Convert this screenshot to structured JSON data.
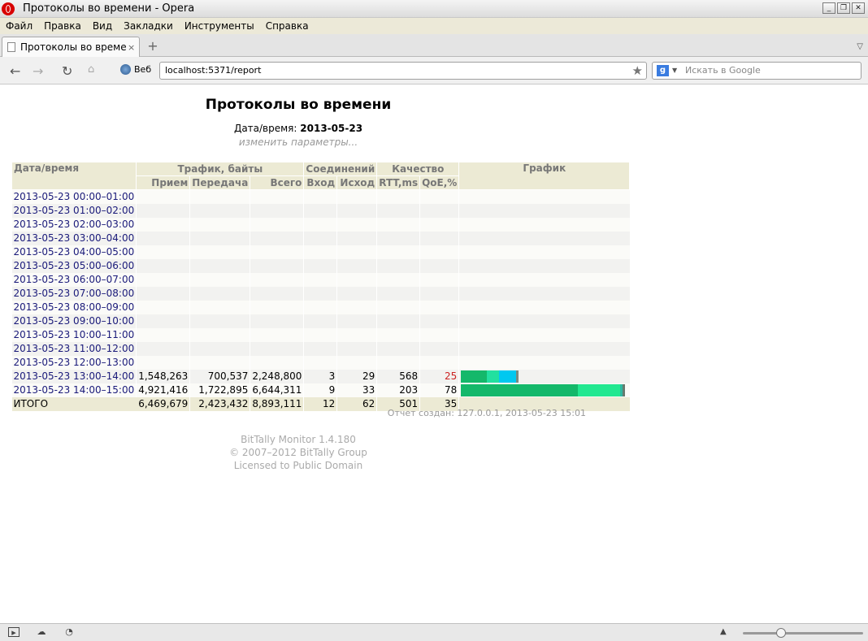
{
  "window": {
    "title": "Протоколы во времени - Opera",
    "buttons": [
      "_",
      "❐",
      "✕"
    ]
  },
  "menu": [
    "Файл",
    "Правка",
    "Вид",
    "Закладки",
    "Инструменты",
    "Справка"
  ],
  "tab": {
    "title": "Протоколы во времени",
    "close": "×",
    "new": "+"
  },
  "nav": {
    "web_label": "Веб",
    "url": "localhost:5371/report",
    "search_placeholder": "Искать в Google",
    "search_engine": "g"
  },
  "page": {
    "title": "Протоколы во времени",
    "date_label": "Дата/время:",
    "date_value": "2013-05-23",
    "change_link": "изменить параметры...",
    "generated": "Отчет создан: 127.0.0.1, 2013-05-23 15:01",
    "credits": [
      "BitTally Monitor 1.4.180",
      "© 2007–2012 BitTally Group",
      "Licensed to Public Domain"
    ]
  },
  "table": {
    "headers": {
      "datetime": "Дата/время",
      "traffic": "Трафик, байты",
      "connections": "Соединений",
      "quality": "Качество",
      "chart": "График",
      "rx": "Прием",
      "tx": "Передача",
      "total": "Всего",
      "in": "Вход",
      "out": "Исход",
      "rtt": "RTT,ms",
      "qoe": "QoE,%"
    },
    "rows": [
      {
        "period": "2013-05-23 00:00–01:00"
      },
      {
        "period": "2013-05-23 01:00–02:00"
      },
      {
        "period": "2013-05-23 02:00–03:00"
      },
      {
        "period": "2013-05-23 03:00–04:00"
      },
      {
        "period": "2013-05-23 04:00–05:00"
      },
      {
        "period": "2013-05-23 05:00–06:00"
      },
      {
        "period": "2013-05-23 06:00–07:00"
      },
      {
        "period": "2013-05-23 07:00–08:00"
      },
      {
        "period": "2013-05-23 08:00–09:00"
      },
      {
        "period": "2013-05-23 09:00–10:00"
      },
      {
        "period": "2013-05-23 10:00–11:00"
      },
      {
        "period": "2013-05-23 11:00–12:00"
      },
      {
        "period": "2013-05-23 12:00–13:00"
      },
      {
        "period": "2013-05-23 13:00–14:00",
        "rx": "1,548,263",
        "tx": "700,537",
        "total": "2,248,800",
        "in": "3",
        "out": "29",
        "rtt": "568",
        "qoe": "25",
        "qoe_low": true,
        "bar_segments": [
          {
            "value": 0.155,
            "color": "#14b86a"
          },
          {
            "value": 0.07,
            "color": "#22e0a0"
          },
          {
            "value": 0.105,
            "color": "#00c8f0"
          },
          {
            "value": 0.015,
            "color": "#7a8a80"
          }
        ]
      },
      {
        "period": "2013-05-23 14:00–15:00",
        "rx": "4,921,416",
        "tx": "1,722,895",
        "total": "6,644,311",
        "in": "9",
        "out": "33",
        "rtt": "203",
        "qoe": "78",
        "bar_segments": [
          {
            "value": 0.7,
            "color": "#14b86a"
          },
          {
            "value": 0.25,
            "color": "#22e890"
          },
          {
            "value": 0.015,
            "color": "#2fb8a0"
          },
          {
            "value": 0.015,
            "color": "#667a6e"
          }
        ]
      }
    ],
    "total_row": {
      "period": "ИТОГО",
      "rx": "6,469,679",
      "tx": "2,423,432",
      "total": "8,893,111",
      "in": "12",
      "out": "62",
      "rtt": "501",
      "qoe": "35"
    }
  },
  "status": {
    "zoom_level": 0.28
  }
}
